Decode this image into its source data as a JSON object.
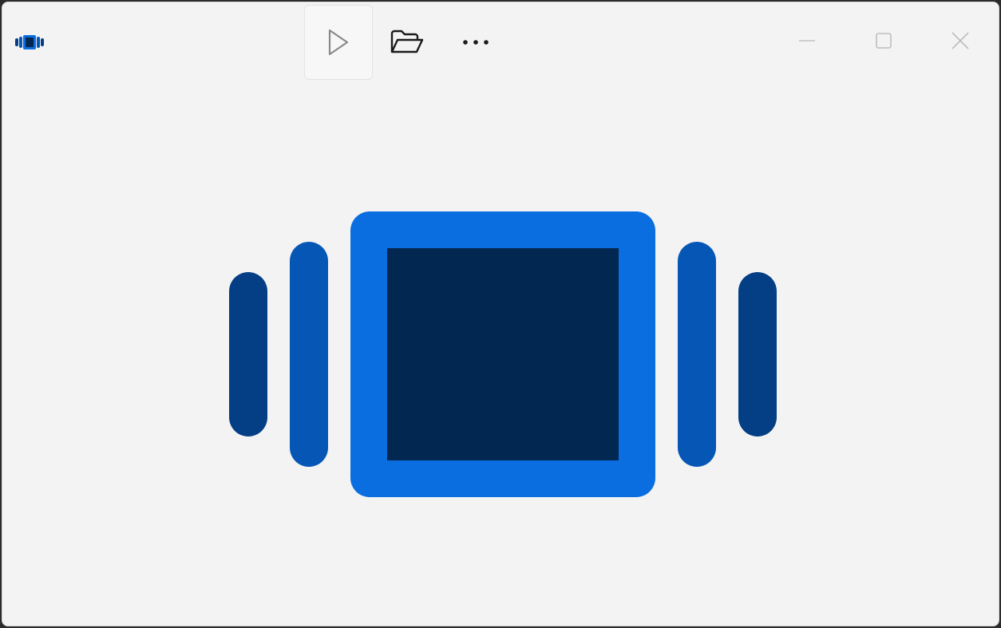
{
  "window": {
    "app_name_icon": "media-player-icon"
  },
  "toolbar": {
    "buttons": [
      {
        "name": "play-button",
        "icon": "play-icon"
      },
      {
        "name": "open-file-button",
        "icon": "folder-open-icon"
      },
      {
        "name": "more-options-button",
        "icon": "more-horizontal-icon"
      }
    ]
  },
  "caption": {
    "buttons": [
      {
        "name": "minimize-button",
        "icon": "minimize-icon"
      },
      {
        "name": "maximize-button",
        "icon": "maximize-icon"
      },
      {
        "name": "close-button",
        "icon": "close-icon"
      }
    ]
  },
  "colors": {
    "window_bg": "#f3f3f3",
    "accent_bright": "#0a6ee0",
    "accent_dark": "#022750",
    "bar_mid": "#0657b5",
    "bar_outer": "#043f86",
    "caption_icon_disabled": "#bdbdbd",
    "toolbar_icon": "#1b1b1b"
  }
}
